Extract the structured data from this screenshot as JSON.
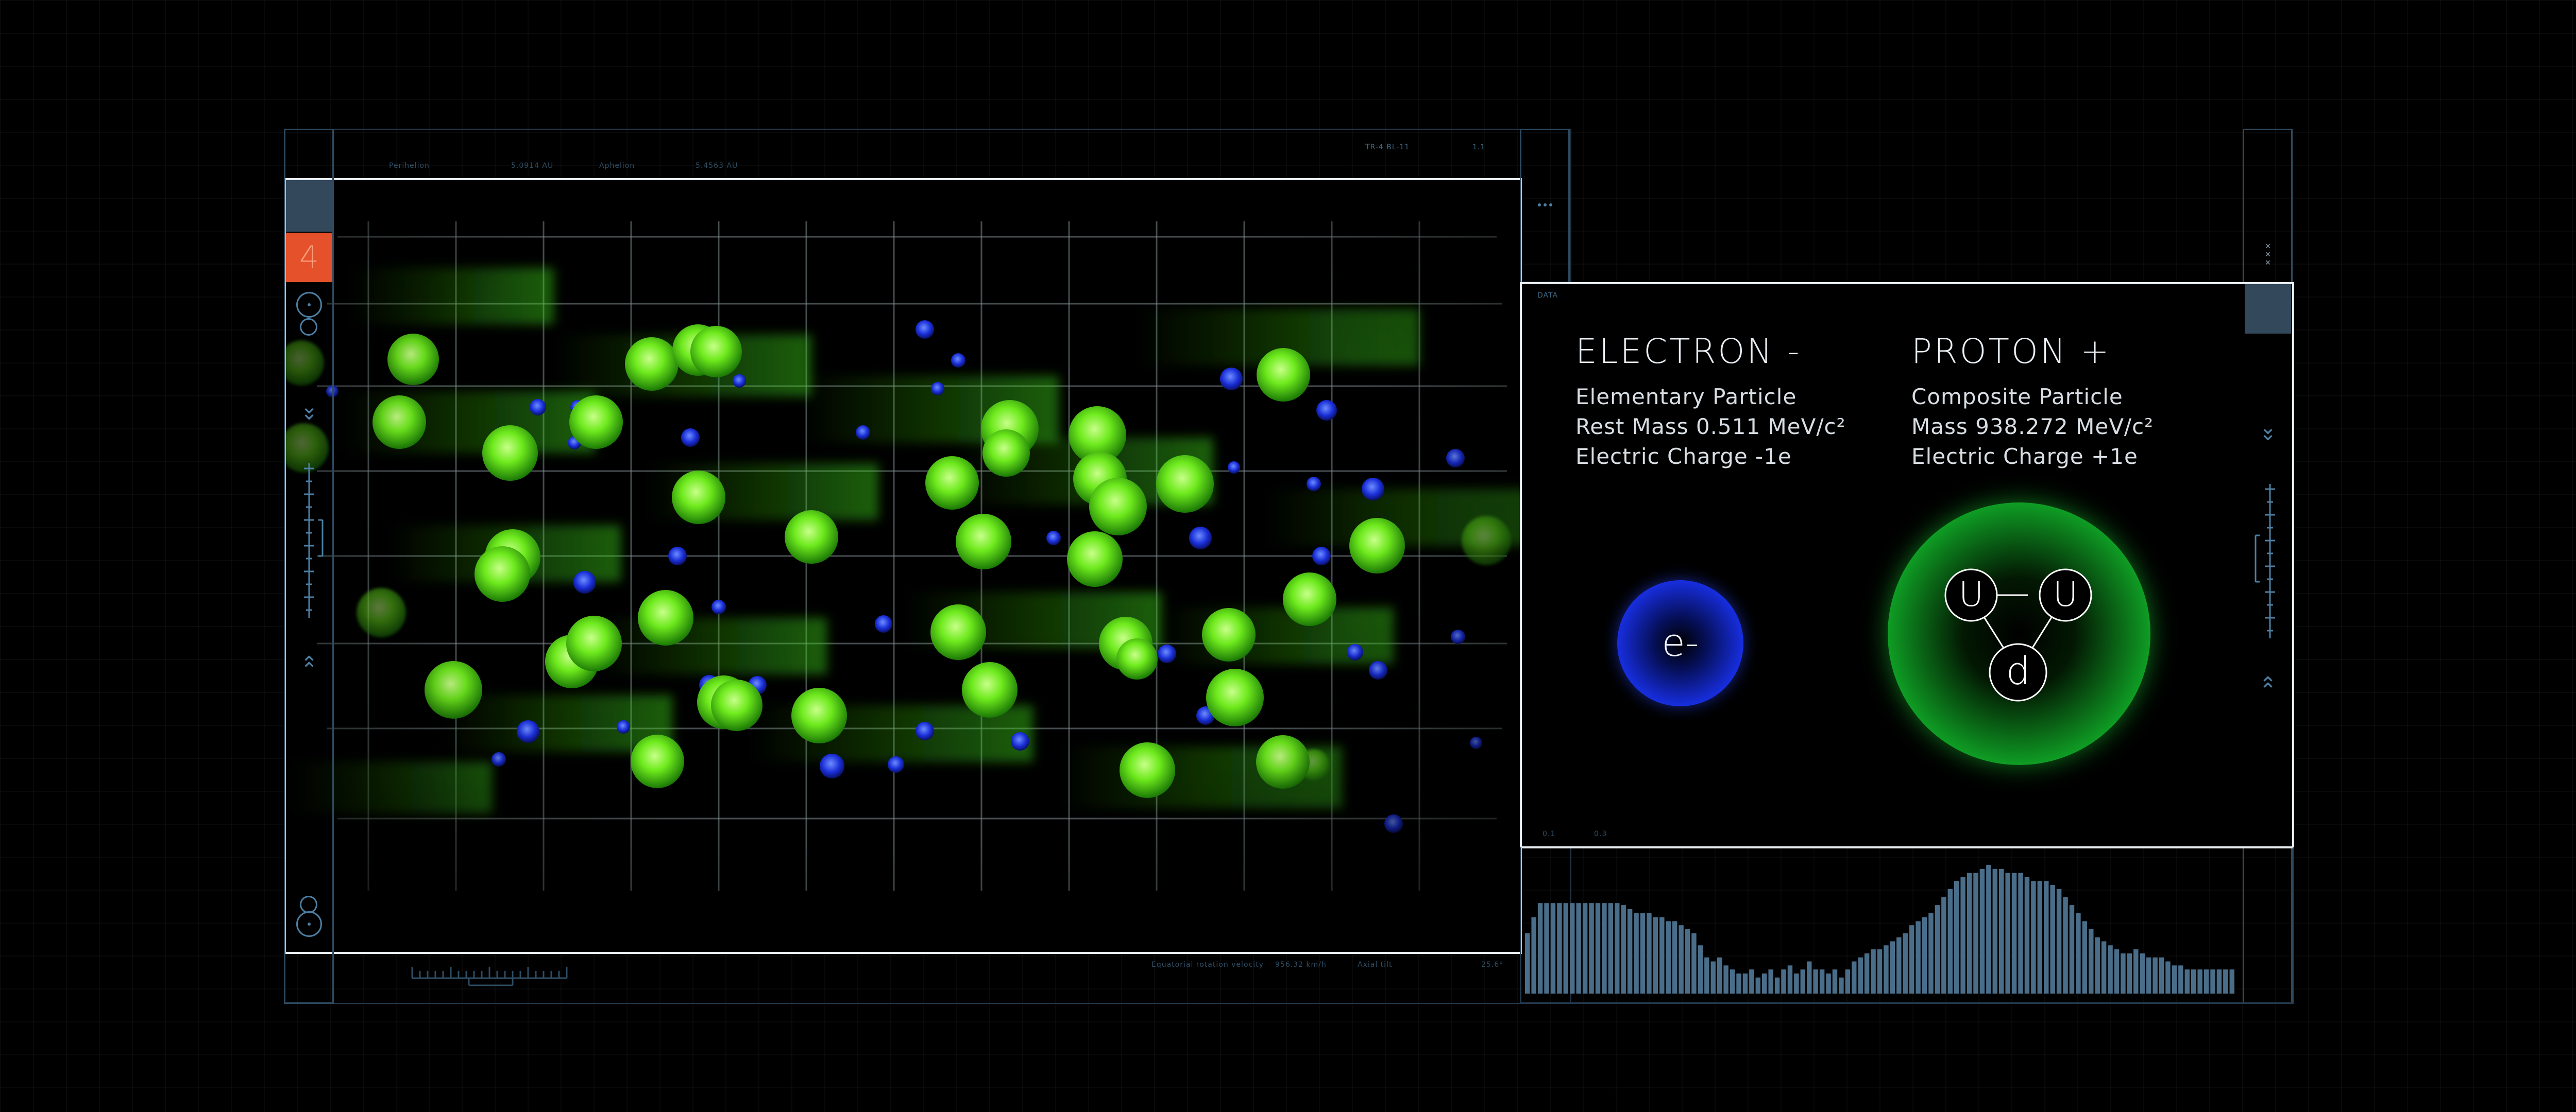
{
  "main_panel": {
    "top_labels": [
      "Perihelion",
      "5.0914 AU",
      "Aphelion",
      "5.4563 AU"
    ],
    "top_right_codes": [
      "TR-4 BL-11",
      "1.1"
    ],
    "bottom_labels": [
      "Equatorial rotation velocity",
      "956.32 km/h",
      "Axial tilt",
      "25.6°"
    ]
  },
  "left_sidebar": {
    "active_number": "4",
    "colors": {
      "active_bg": "#e4512a",
      "top_cell": "#33485a",
      "line": "#2d4a60",
      "icon": "#4d7fa3"
    },
    "icons": [
      "target-ring-icon",
      "chevron-double-down-icon",
      "scale-ruler-icon",
      "chevron-double-up-icon",
      "target-ring-icon"
    ]
  },
  "info_panel": {
    "data_label": "DATA",
    "small_axis_labels": [
      "0.1",
      "0.3"
    ],
    "electron": {
      "title": "ELECTRON -",
      "lines": [
        "Elementary Particle",
        "Rest Mass 0.511 MeV/c²",
        "Electric Charge -1e"
      ],
      "symbol": "e-",
      "color": "#1b35ff"
    },
    "proton": {
      "title": "PROTON +",
      "lines": [
        "Composite Particle",
        "Mass 938.272 MeV/c²",
        "Electric Charge +1e"
      ],
      "quarks": [
        "U",
        "U",
        "d"
      ],
      "color": "#1dff3a"
    }
  },
  "right_sidebar": {
    "icons": [
      "close-icon",
      "chevron-double-down-icon",
      "scale-ruler-icon",
      "chevron-double-up-icon"
    ]
  },
  "histogram": {
    "values": [
      30,
      38,
      45,
      45,
      45,
      45,
      45,
      45,
      45,
      45,
      45,
      45,
      45,
      45,
      45,
      44,
      42,
      40,
      40,
      40,
      38,
      38,
      36,
      36,
      34,
      32,
      30,
      24,
      18,
      16,
      18,
      14,
      12,
      10,
      10,
      12,
      8,
      10,
      12,
      8,
      12,
      14,
      10,
      12,
      16,
      12,
      12,
      10,
      12,
      8,
      12,
      16,
      18,
      20,
      22,
      22,
      24,
      26,
      28,
      30,
      34,
      36,
      38,
      40,
      44,
      48,
      52,
      56,
      58,
      60,
      60,
      62,
      64,
      62,
      62,
      60,
      60,
      60,
      58,
      56,
      56,
      56,
      54,
      52,
      48,
      44,
      40,
      36,
      32,
      28,
      26,
      24,
      22,
      20,
      20,
      22,
      20,
      18,
      18,
      18,
      16,
      14,
      14,
      12,
      12,
      12,
      12,
      12,
      12,
      12,
      12
    ],
    "max": 64,
    "bar_color": "#4a6e8a"
  }
}
